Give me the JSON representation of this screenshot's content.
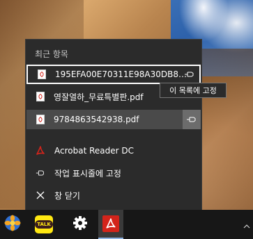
{
  "desktop": {
    "wallpaper": "desert-dunes"
  },
  "jump_list": {
    "section_title": "최근 항목",
    "recent_items": [
      {
        "name": "195EFA00E70311E98A30DB8C6...",
        "icon": "pdf-file-icon",
        "state": "focused",
        "pin": "pin-icon"
      },
      {
        "name": "영잘열하_무료특별판.pdf",
        "icon": "pdf-file-icon",
        "state": "normal"
      },
      {
        "name": "9784863542938.pdf",
        "icon": "pdf-file-icon",
        "state": "hovered",
        "pin": "pin-icon"
      }
    ],
    "tasks": [
      {
        "label": "Acrobat Reader DC",
        "icon": "acrobat-icon"
      },
      {
        "label": "작업 표시줄에 고정",
        "icon": "pin-icon"
      },
      {
        "label": "창 닫기",
        "icon": "close-icon"
      }
    ],
    "tooltip": "이 목록에 고정"
  },
  "taskbar": {
    "apps": [
      {
        "name": "photo-viewer-app",
        "icon": "flower-icon"
      },
      {
        "name": "kakaotalk-app",
        "icon": "talk-icon",
        "label": "TALK"
      },
      {
        "name": "settings-app",
        "icon": "gear-icon"
      },
      {
        "name": "acrobat-reader-app",
        "icon": "acrobat-icon",
        "active": true
      }
    ],
    "tray": {
      "icon": "chevron-up-icon"
    }
  },
  "colors": {
    "menu_bg": "#2b2b2b",
    "hover_bg": "#4a4a4a",
    "acrobat_red": "#d3241b",
    "talk_yellow": "#ffe812",
    "taskbar_bg": "#171717",
    "active_accent": "#8fb5e6"
  }
}
